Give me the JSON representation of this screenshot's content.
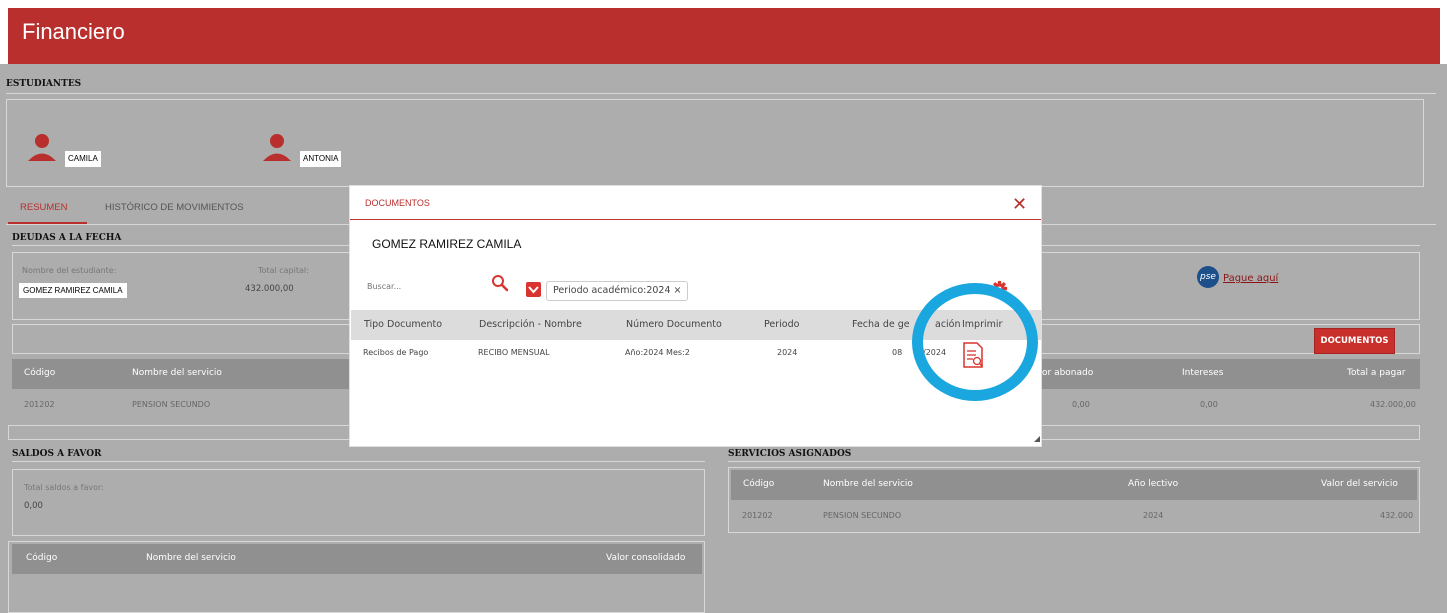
{
  "app": {
    "title": "Financiero"
  },
  "students": {
    "heading": "ESTUDIANTES",
    "items": [
      {
        "name": "CAMILA"
      },
      {
        "name": "ANTONIA"
      }
    ]
  },
  "tabs": [
    {
      "label": "RESUMEN"
    },
    {
      "label": "HISTÓRICO DE MOVIMIENTOS"
    }
  ],
  "debts": {
    "heading": "DEUDAS A LA FECHA",
    "student_label": "Nombre del estudiante:",
    "student_value": "GOMEZ RAMIREZ CAMILA",
    "capital_label": "Total capital:",
    "capital_value": "432.000,00",
    "pay_link": "Pague aquí",
    "pse_logo": "pse",
    "documents_button": "DOCUMENTOS",
    "columns": [
      "Código",
      "Nombre del servicio",
      "or abonado",
      "Intereses",
      "Total a pagar"
    ],
    "rows": [
      {
        "codigo": "201202",
        "nombre": "PENSION SECUNDO",
        "abonado": "0,00",
        "intereses": "0,00",
        "total": "432.000,00"
      }
    ]
  },
  "credits": {
    "heading": "SALDOS A FAVOR",
    "total_label": "Total saldos a favor:",
    "total_value": "0,00",
    "columns": [
      "Código",
      "Nombre del servicio",
      "Valor consolidado"
    ]
  },
  "services": {
    "heading": "SERVICIOS ASIGNADOS",
    "columns": [
      "Código",
      "Nombre del servicio",
      "Año lectivo",
      "Valor del servicio"
    ],
    "rows": [
      {
        "codigo": "201202",
        "nombre": "PENSION SECUNDO",
        "anio": "2024",
        "valor": "432.000"
      }
    ]
  },
  "modal": {
    "title": "DOCUMENTOS",
    "student": "GOMEZ RAMIREZ CAMILA",
    "search_placeholder": "Buscar...",
    "filter_tag": "Periodo académico:2024 ×",
    "columns": [
      "Tipo Documento",
      "Descripción - Nombre",
      "Número Documento",
      "Periodo",
      "Fecha de ge",
      "ación",
      "Imprimir"
    ],
    "rows": [
      {
        "tipo": "Recibos de Pago",
        "descripcion": "RECIBO MENSUAL",
        "numero": "Año:2024 Mes:2",
        "periodo": "2024",
        "fecha_a": "08",
        "fecha_b": "/2024"
      }
    ]
  },
  "colors": {
    "brand": "#b82f2d",
    "highlight_ring": "#1aa6df"
  },
  "icons": [
    "user-icon",
    "search-icon",
    "gear-icon",
    "print-icon",
    "close-icon",
    "resize-grip-icon"
  ]
}
